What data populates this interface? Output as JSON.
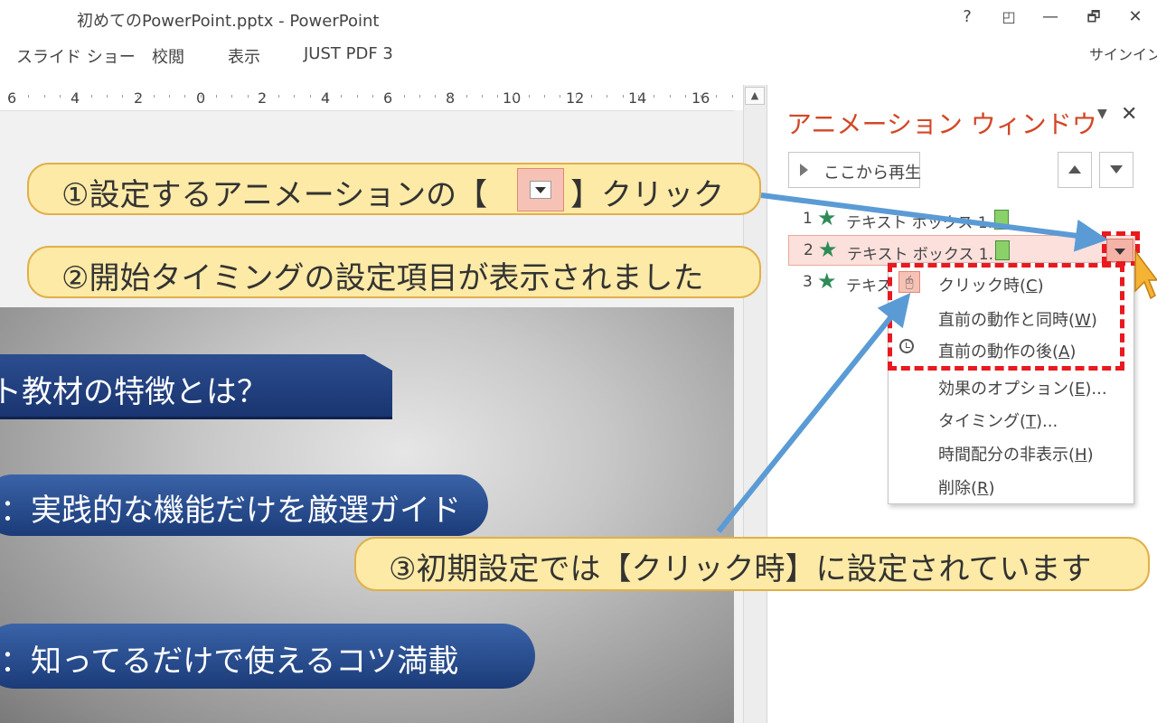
{
  "window": {
    "title": "初めてのPowerPoint.pptx - PowerPoint",
    "help": "?",
    "ribbon_display": "◰",
    "minimize": "—",
    "restore": "🗗",
    "close": "✕"
  },
  "ribbon": {
    "tabs": [
      "スライド ショー",
      "校閲",
      "表示",
      "JUST PDF 3"
    ],
    "signin": "サインイン"
  },
  "ruler": {
    "labels": [
      "6",
      "4",
      "2",
      "0",
      "2",
      "4",
      "6",
      "8",
      "10",
      "12",
      "14",
      "16"
    ]
  },
  "slide": {
    "title_shape": "ト教材の特徴とは？",
    "item2": "：実践的な機能だけを厳選ガイド",
    "item3": "：知ってるだけで使えるコツ満載"
  },
  "animation_pane": {
    "title": "アニメーション ウィンドウ",
    "dropdown": "▼",
    "close": "✕",
    "play_from": "ここから再生",
    "items": [
      {
        "num": "1",
        "name": "テキスト ボックス 1..."
      },
      {
        "num": "2",
        "name": "テキスト ボックス 1..."
      },
      {
        "num": "3",
        "name": "テキス"
      }
    ],
    "star_icon": "★"
  },
  "context_menu": {
    "items": [
      {
        "pre": "クリック時(",
        "key": "C",
        "post": ")"
      },
      {
        "pre": "直前の動作と同時(",
        "key": "W",
        "post": ")"
      },
      {
        "pre": "直前の動作の後(",
        "key": "A",
        "post": ")"
      },
      {
        "pre": "効果のオプション(",
        "key": "E",
        "post": ")..."
      },
      {
        "pre": "タイミング(",
        "key": "T",
        "post": ")..."
      },
      {
        "pre": "時間配分の非表示(",
        "key": "H",
        "post": ")"
      },
      {
        "pre": "削除(",
        "key": "R",
        "post": ")"
      }
    ]
  },
  "callouts": {
    "c1_before": "①設定するアニメーションの【",
    "c1_after": "】クリック",
    "c2": "②開始タイミングの設定項目が表示されました",
    "c3": "③初期設定では【クリック時】に設定されています"
  },
  "colors": {
    "accent_orange": "#d24726",
    "highlight_red": "#e8191f",
    "arrow_blue": "#5b9bd5",
    "callout_fill": "#fdeaa6"
  }
}
